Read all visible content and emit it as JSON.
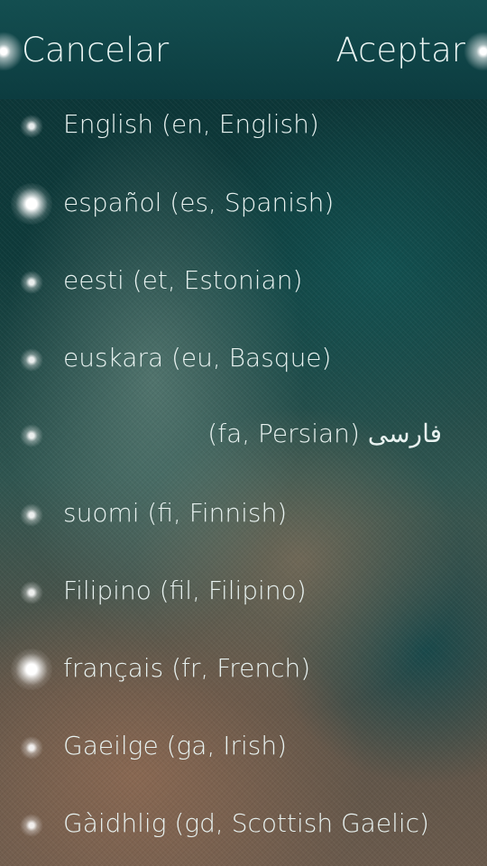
{
  "header": {
    "cancel_label": "Cancelar",
    "accept_label": "Aceptar"
  },
  "languages": [
    {
      "label": "English (en, English)",
      "selected": false
    },
    {
      "label": "español (es, Spanish)",
      "selected": true
    },
    {
      "label": "eesti (et, Estonian)",
      "selected": false
    },
    {
      "label": "euskara (eu, Basque)",
      "selected": false
    },
    {
      "label": "فارسی (fa, Persian)",
      "selected": false
    },
    {
      "label": "suomi (fi, Finnish)",
      "selected": false
    },
    {
      "label": "Filipino (fil, Filipino)",
      "selected": false
    },
    {
      "label": "français (fr, French)",
      "selected": false
    },
    {
      "label": "Gaeilge (ga, Irish)",
      "selected": false
    },
    {
      "label": "Gàidhlig (gd, Scottish Gaelic)",
      "selected": false
    }
  ]
}
